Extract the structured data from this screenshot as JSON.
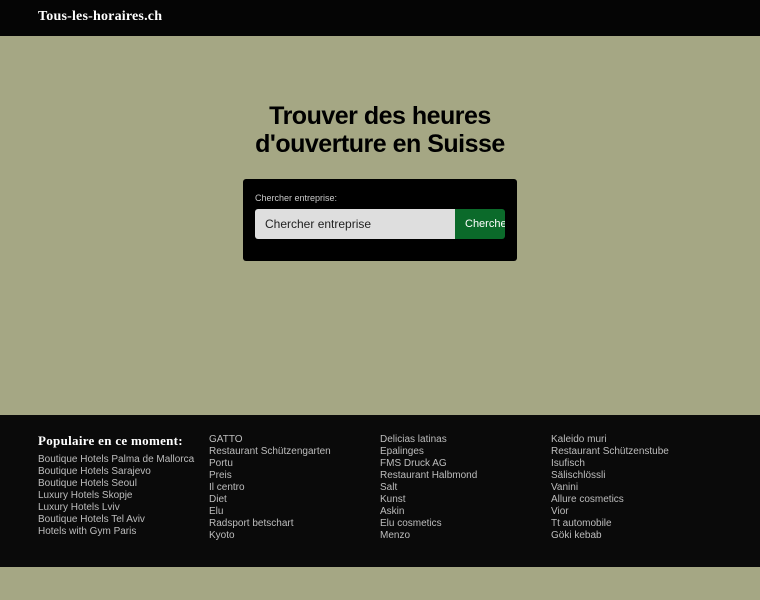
{
  "header": {
    "logo": "Tous-les-horaires.ch"
  },
  "hero": {
    "title_line1": "Trouver des heures",
    "title_line2": "d'ouverture en Suisse"
  },
  "search": {
    "label": "Chercher entreprise:",
    "placeholder": "Chercher entreprise",
    "button_label": "Chercher"
  },
  "footer": {
    "popular_title": "Populaire en ce moment:",
    "col1": [
      "Boutique Hotels Palma de Mallorca",
      "Boutique Hotels Sarajevo",
      "Boutique Hotels Seoul",
      "Luxury Hotels Skopje",
      "Luxury Hotels Lviv",
      "Boutique Hotels Tel Aviv",
      "Hotels with Gym Paris"
    ],
    "col2": [
      "GATTO",
      "Restaurant Schützengarten",
      "Portu",
      "Preis",
      "Il centro",
      "Diet",
      "Elu",
      "Radsport betschart",
      "Kyoto"
    ],
    "col3": [
      "Delicias latinas",
      "Epalinges",
      "FMS Druck AG",
      "Restaurant Halbmond",
      "Salt",
      "Kunst",
      "Askin",
      "Elu cosmetics",
      "Menzo"
    ],
    "col4": [
      "Kaleido muri",
      "Restaurant Schützenstube",
      "Isufisch",
      "Sälischlössli",
      "Vanini",
      "Allure cosmetics",
      "Vior",
      "Tt automobile",
      "Göki kebab"
    ]
  }
}
